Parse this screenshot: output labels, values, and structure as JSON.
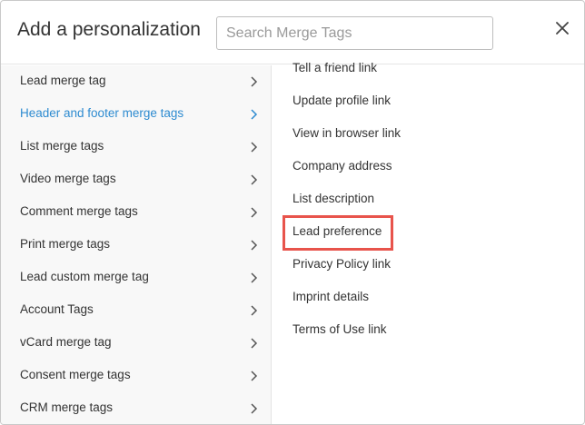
{
  "dialog": {
    "title": "Add a personalization",
    "search_placeholder": "Search Merge Tags",
    "search_value": "",
    "close_icon": "close-icon"
  },
  "categories": [
    {
      "label": "Lead merge tag"
    },
    {
      "label": "Header and footer merge tags",
      "active": true
    },
    {
      "label": "List merge tags"
    },
    {
      "label": "Video merge tags"
    },
    {
      "label": "Comment merge tags"
    },
    {
      "label": "Print merge tags"
    },
    {
      "label": "Lead custom merge tag"
    },
    {
      "label": "Account Tags"
    },
    {
      "label": "vCard merge tag"
    },
    {
      "label": "Consent merge tags"
    },
    {
      "label": "CRM merge tags"
    }
  ],
  "tags": [
    {
      "label": "Tell a friend link"
    },
    {
      "label": "Update profile link"
    },
    {
      "label": "View in browser link"
    },
    {
      "label": "Company address"
    },
    {
      "label": "List description"
    },
    {
      "label": "Lead preference",
      "highlighted": true
    },
    {
      "label": "Privacy Policy link"
    },
    {
      "label": "Imprint details"
    },
    {
      "label": "Terms of Use link"
    }
  ],
  "colors": {
    "active": "#2e8bd0",
    "highlight": "#e8544c",
    "text": "#333333"
  }
}
